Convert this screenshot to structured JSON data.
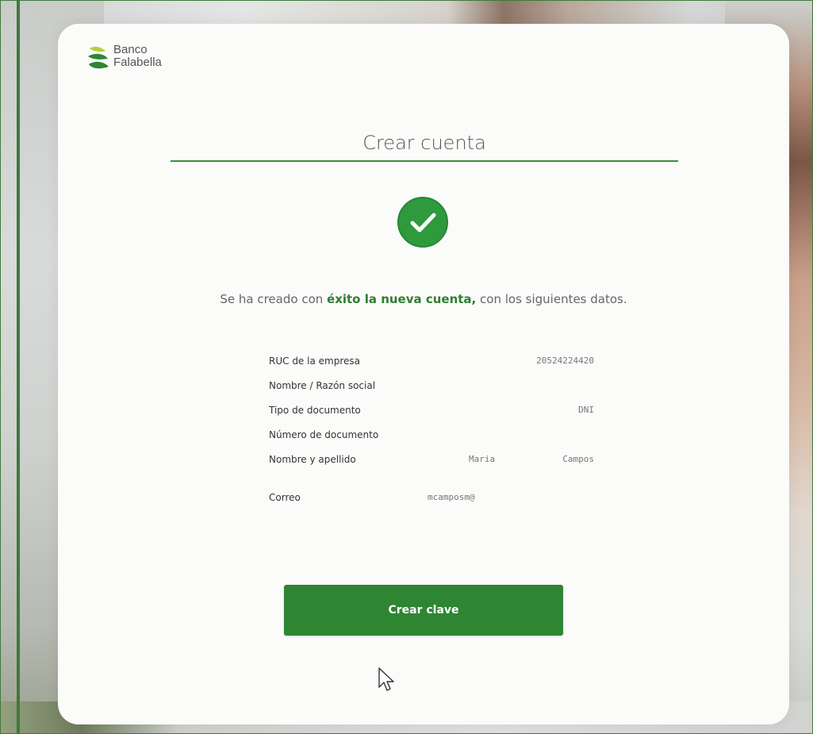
{
  "brand": {
    "name_line1": "Banco",
    "name_line2": "Falabella",
    "color": "#2e8532"
  },
  "page": {
    "title": "Crear cuenta",
    "success_icon": "check-circle-icon",
    "message_prefix": "Se ha creado con ",
    "message_highlight": "éxito la nueva cuenta,",
    "message_suffix": " con los siguientes datos."
  },
  "details": {
    "ruc_label": "RUC de la empresa",
    "ruc_value": "20524224420",
    "razon_label": "Nombre / Razón social",
    "razon_value": "",
    "tipo_label": "Tipo de documento",
    "tipo_value": "DNI",
    "numero_label": "Número de documento",
    "numero_value": "",
    "nombre_label": "Nombre y apellido",
    "nombre_first": "Maria",
    "nombre_last": "Campos",
    "correo_label": "Correo",
    "correo_value": "mcamposm@"
  },
  "actions": {
    "create_password_label": "Crear clave"
  }
}
